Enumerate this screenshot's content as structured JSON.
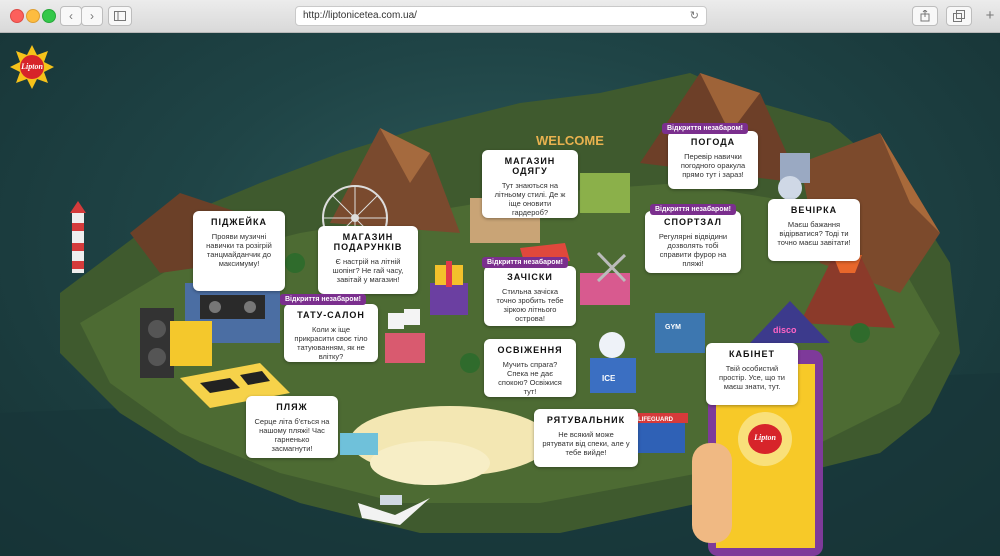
{
  "browser": {
    "url": "http://liptonicetea.com.ua/"
  },
  "brand": {
    "logo_text": "Lipton"
  },
  "phone": {
    "logo_text": "Lipton"
  },
  "cards": {
    "pidjeyka": {
      "title": "ПІДЖЕЙКА",
      "text": "Прояви музичні навички та розігрій танцмайданчик до максимуму!"
    },
    "podarunky": {
      "title": "МАГАЗИН ПОДАРУНКІВ",
      "text": "Є настрій на літній шопінг? Не гай часу, завітай у магазин!"
    },
    "odyag": {
      "title": "МАГАЗИН ОДЯГУ",
      "text": "Тут знаються на літньому стилі. Де ж іще оновити гардероб?"
    },
    "pogoda": {
      "badge": "Відкриття незабаром!",
      "title": "ПОГОДА",
      "text": "Перевір навички погодного оракула прямо тут і зараз!"
    },
    "sportzal": {
      "badge": "Відкриття незабаром!",
      "title": "СПОРТЗАЛ",
      "text": "Регулярні відвідини дозволять тобі справити фурор на пляжі!"
    },
    "vechirka": {
      "title": "ВЕЧІРКА",
      "text": "Маєш бажання відірватися? Тоді ти точно маєш завітати!"
    },
    "zachisky": {
      "badge": "Відкриття незабаром!",
      "title": "ЗАЧІСКИ",
      "text": "Стильна зачіска точно зробить тебе зіркою літнього острова!"
    },
    "tatu": {
      "badge": "Відкриття незабаром!",
      "title": "ТАТУ-САЛОН",
      "text": "Коли ж іще прикрасити своє тіло татуюванням, як не влітку?"
    },
    "osvizhennya": {
      "title": "ОСВІЖЕННЯ",
      "text": "Мучить спрага? Спека не дає спокою? Освіжися тут!"
    },
    "kabinet": {
      "title": "КАБІНЕТ",
      "text": "Твій особистий простір. Усе, що ти маєш знати, тут."
    },
    "plyazh": {
      "title": "ПЛЯЖ",
      "text": "Серце літа б'ється на нашому пляжі! Час гарненько засмагнути!"
    },
    "ryatuvalnyk": {
      "title": "РЯТУВАЛЬНИК",
      "text": "Не всякий може рятувати від спеки, але у тебе вийде!"
    }
  },
  "signs": {
    "welcome": "WELCOME",
    "disco": "disco",
    "gym": "GYM",
    "ice": "ICE",
    "lifeguard": "LIFEGUARD"
  }
}
